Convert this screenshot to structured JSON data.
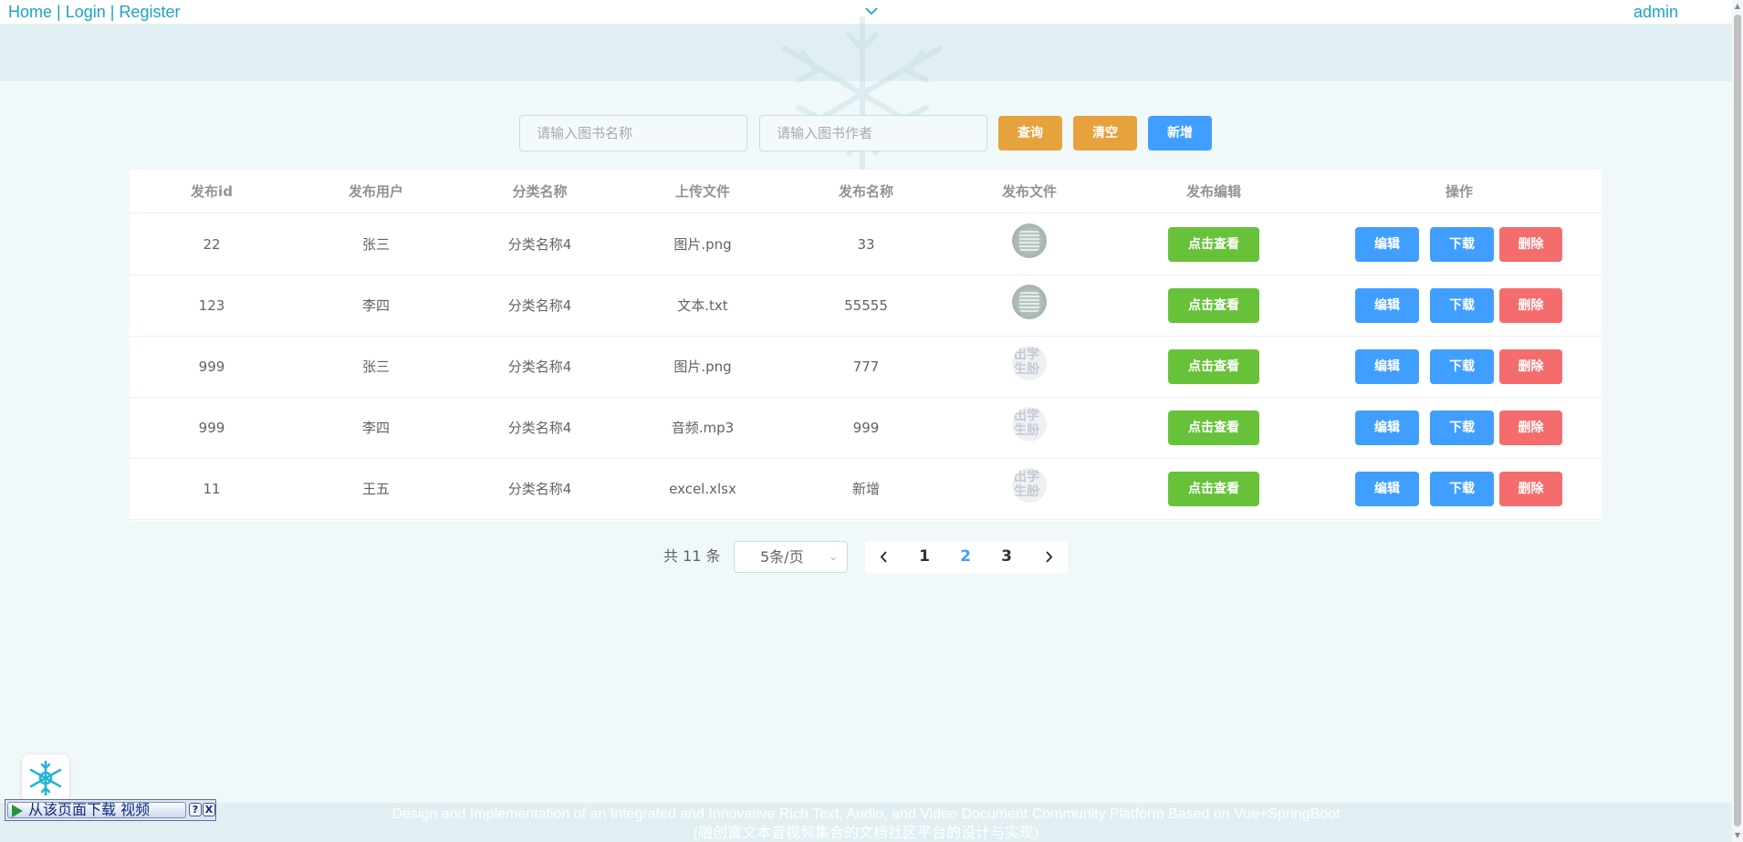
{
  "nav": {
    "home": "Home",
    "login": "Login",
    "register": "Register",
    "sep": "|",
    "user": "admin"
  },
  "search": {
    "name_placeholder": "请输入图书名称",
    "author_placeholder": "请输入图书作者",
    "query_label": "查询",
    "clear_label": "清空",
    "add_label": "新增"
  },
  "table": {
    "headers": [
      "发布id",
      "发布用户",
      "分类名称",
      "上传文件",
      "发布名称",
      "发布文件",
      "发布编辑",
      "操作"
    ],
    "rows": [
      {
        "id": "22",
        "user": "张三",
        "category": "分类名称4",
        "file": "图片.png",
        "name": "33",
        "thumb": "image-thumb"
      },
      {
        "id": "123",
        "user": "李四",
        "category": "分类名称4",
        "file": "文本.txt",
        "name": "55555",
        "thumb": "image-thumb"
      },
      {
        "id": "999",
        "user": "张三",
        "category": "分类名称4",
        "file": "图片.png",
        "name": "777",
        "thumb": "text-thumb"
      },
      {
        "id": "999",
        "user": "李四",
        "category": "分类名称4",
        "file": "音频.mp3",
        "name": "999",
        "thumb": "text-thumb"
      },
      {
        "id": "11",
        "user": "王五",
        "category": "分类名称4",
        "file": "excel.xlsx",
        "name": "新增",
        "thumb": "text-thumb"
      }
    ],
    "view_label": "点击查看",
    "edit_label": "编辑",
    "download_label": "下载",
    "delete_label": "删除"
  },
  "pagination": {
    "total": "共 11 条",
    "page_size": "5条/页",
    "pages": [
      "1",
      "2",
      "3"
    ],
    "current": "2"
  },
  "footer": {
    "line1": "Design and Implementation of an Integrated and Innovative Rich Text, Audio, and Video Document Community Platform Based on Vue+SpringBoot",
    "line2": "(融创富文本音视频集合的文档社区平台的设计与实现)"
  },
  "download_bar": {
    "label": "从该页面下载 视频",
    "help": "?",
    "close": "X"
  },
  "colors": {
    "accent": "#409eff",
    "warning": "#e6a23c",
    "success": "#67c23a",
    "danger": "#f56c6c",
    "link": "#1aa3c9"
  }
}
